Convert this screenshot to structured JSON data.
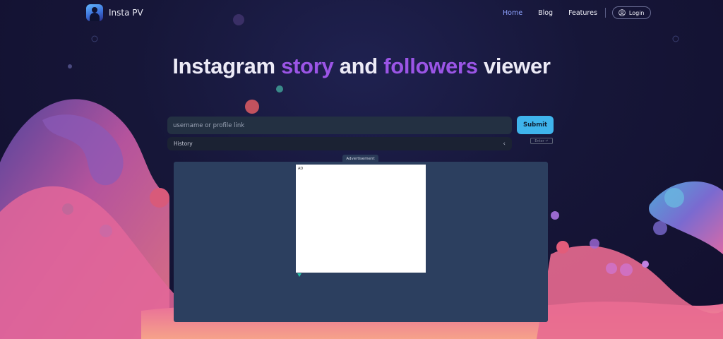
{
  "header": {
    "brand": "Insta PV",
    "nav": [
      {
        "label": "Home",
        "active": true
      },
      {
        "label": "Blog",
        "active": false
      },
      {
        "label": "Features",
        "active": false
      }
    ],
    "login_label": "Login"
  },
  "hero": {
    "title_part1": "Instagram ",
    "title_accent1": "story",
    "title_part2": " and ",
    "title_accent2": "followers",
    "title_part3": " viewer"
  },
  "search": {
    "placeholder": "username or profile link",
    "value": "",
    "submit_label": "Submit",
    "history_label": "History",
    "enter_hint": "Enter ↵"
  },
  "ad": {
    "tag": "Advertisement",
    "label": "AD"
  },
  "colors": {
    "accent": "#9b55e6",
    "nav_active": "#8ea2ff",
    "submit": "#3fb4ec",
    "ad_panel": "#2c3f5f"
  },
  "icons": {
    "logo": "avatar-logo-icon",
    "login": "user-circle-icon",
    "history_toggle": "chevron-left-icon"
  }
}
